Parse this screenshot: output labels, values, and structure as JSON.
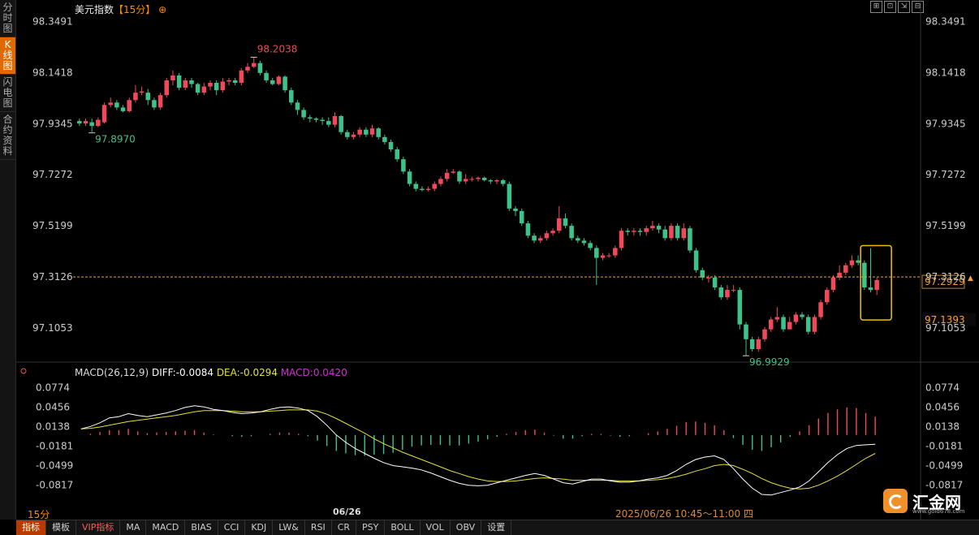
{
  "sidebar": {
    "items": [
      "分时图",
      "K线图",
      "闪电图",
      "合约资料"
    ],
    "active_index": 1
  },
  "header": {
    "name": "美元指数",
    "period": "【15分】",
    "add_icon": "⊕"
  },
  "window_buttons": [
    "⊞",
    "⊡",
    "⇲",
    "⊟"
  ],
  "colors": {
    "up": "#f04a5a",
    "down": "#3fc28a",
    "price_line": "#e8a33c",
    "diff": "#ffffff",
    "dea": "#e6e03a",
    "macd": "#d030d0",
    "highlight_box": "#f0c000"
  },
  "chart_data": [
    {
      "type": "candlestick",
      "title": "美元指数 15分",
      "y_ticks": [
        "98.3491",
        "98.1418",
        "97.9345",
        "97.7272",
        "97.5199",
        "97.3126",
        "97.1053"
      ],
      "ylim": [
        97.02,
        98.37
      ],
      "current_price": "97.2929",
      "current_line": 97.3126,
      "box_low_label": "97.1393",
      "annotations": {
        "high": "98.2038",
        "low": "96.9929",
        "left_low": "97.8970"
      },
      "x_label": "06/26",
      "date_range": "2025/06/26 10:45～11:00 四",
      "candles": [
        [
          97.945,
          97.935,
          97.955,
          97.925
        ],
        [
          97.935,
          97.945,
          97.955,
          97.925
        ],
        [
          97.94,
          97.925,
          97.955,
          97.9
        ],
        [
          97.925,
          97.95,
          97.96,
          97.92
        ],
        [
          97.94,
          98.01,
          98.02,
          97.935
        ],
        [
          98.01,
          98.02,
          98.04,
          98.0
        ],
        [
          98.02,
          98.0,
          98.03,
          97.99
        ],
        [
          98.0,
          97.985,
          98.01,
          97.98
        ],
        [
          97.985,
          98.03,
          98.04,
          97.98
        ],
        [
          98.03,
          98.06,
          98.09,
          98.02
        ],
        [
          98.06,
          98.065,
          98.085,
          98.05
        ],
        [
          98.06,
          98.03,
          98.075,
          98.01
        ],
        [
          98.03,
          98.0,
          98.04,
          97.99
        ],
        [
          98.0,
          98.05,
          98.06,
          97.99
        ],
        [
          98.05,
          98.11,
          98.12,
          98.04
        ],
        [
          98.11,
          98.13,
          98.15,
          98.09
        ],
        [
          98.13,
          98.08,
          98.14,
          98.07
        ],
        [
          98.08,
          98.11,
          98.12,
          98.07
        ],
        [
          98.11,
          98.095,
          98.12,
          98.08
        ],
        [
          98.095,
          98.06,
          98.1,
          98.05
        ],
        [
          98.06,
          98.085,
          98.1,
          98.05
        ],
        [
          98.085,
          98.1,
          98.11,
          98.07
        ],
        [
          98.1,
          98.07,
          98.11,
          98.05
        ],
        [
          98.07,
          98.105,
          98.12,
          98.06
        ],
        [
          98.105,
          98.11,
          98.12,
          98.09
        ],
        [
          98.11,
          98.1,
          98.12,
          98.09
        ],
        [
          98.1,
          98.15,
          98.16,
          98.09
        ],
        [
          98.15,
          98.165,
          98.18,
          98.14
        ],
        [
          98.165,
          98.18,
          98.2038,
          98.16
        ],
        [
          98.18,
          98.14,
          98.19,
          98.13
        ],
        [
          98.14,
          98.11,
          98.15,
          98.1
        ],
        [
          98.11,
          98.095,
          98.12,
          98.09
        ],
        [
          98.095,
          98.125,
          98.13,
          98.09
        ],
        [
          98.125,
          98.07,
          98.13,
          98.06
        ],
        [
          98.07,
          98.02,
          98.08,
          98.01
        ],
        [
          98.02,
          97.99,
          98.03,
          97.97
        ],
        [
          97.99,
          97.96,
          98.0,
          97.95
        ],
        [
          97.96,
          97.955,
          97.97,
          97.94
        ],
        [
          97.955,
          97.95,
          97.96,
          97.94
        ],
        [
          97.95,
          97.945,
          97.96,
          97.93
        ],
        [
          97.945,
          97.93,
          97.96,
          97.92
        ],
        [
          97.93,
          97.965,
          97.98,
          97.92
        ],
        [
          97.965,
          97.9,
          97.97,
          97.89
        ],
        [
          97.9,
          97.88,
          97.91,
          97.87
        ],
        [
          97.88,
          97.89,
          97.9,
          97.87
        ],
        [
          97.89,
          97.91,
          97.92,
          97.88
        ],
        [
          97.91,
          97.89,
          97.92,
          97.88
        ],
        [
          97.89,
          97.915,
          97.93,
          97.88
        ],
        [
          97.915,
          97.88,
          97.92,
          97.87
        ],
        [
          97.88,
          97.86,
          97.89,
          97.85
        ],
        [
          97.86,
          97.83,
          97.87,
          97.82
        ],
        [
          97.83,
          97.79,
          97.84,
          97.78
        ],
        [
          97.79,
          97.74,
          97.8,
          97.73
        ],
        [
          97.74,
          97.69,
          97.75,
          97.68
        ],
        [
          97.69,
          97.67,
          97.7,
          97.66
        ],
        [
          97.67,
          97.665,
          97.68,
          97.66
        ],
        [
          97.665,
          97.67,
          97.68,
          97.66
        ],
        [
          97.67,
          97.69,
          97.7,
          97.66
        ],
        [
          97.69,
          97.71,
          97.72,
          97.68
        ],
        [
          97.71,
          97.735,
          97.75,
          97.7
        ],
        [
          97.735,
          97.74,
          97.75,
          97.73
        ],
        [
          97.74,
          97.7,
          97.745,
          97.69
        ],
        [
          97.7,
          97.71,
          97.73,
          97.69
        ],
        [
          97.71,
          97.71,
          97.72,
          97.7
        ],
        [
          97.71,
          97.715,
          97.72,
          97.7
        ],
        [
          97.715,
          97.705,
          97.72,
          97.7
        ],
        [
          97.705,
          97.7,
          97.71,
          97.69
        ],
        [
          97.7,
          97.705,
          97.71,
          97.69
        ],
        [
          97.705,
          97.69,
          97.71,
          97.68
        ],
        [
          97.69,
          97.59,
          97.7,
          97.58
        ],
        [
          97.59,
          97.58,
          97.6,
          97.56
        ],
        [
          97.58,
          97.53,
          97.59,
          97.52
        ],
        [
          97.53,
          97.48,
          97.54,
          97.47
        ],
        [
          97.48,
          97.46,
          97.49,
          97.45
        ],
        [
          97.46,
          97.47,
          97.48,
          97.45
        ],
        [
          97.47,
          97.49,
          97.5,
          97.46
        ],
        [
          97.49,
          97.5,
          97.51,
          97.48
        ],
        [
          97.5,
          97.55,
          97.6,
          97.49
        ],
        [
          97.55,
          97.52,
          97.57,
          97.51
        ],
        [
          97.52,
          97.47,
          97.53,
          97.46
        ],
        [
          97.47,
          97.46,
          97.48,
          97.45
        ],
        [
          97.46,
          97.45,
          97.47,
          97.44
        ],
        [
          97.45,
          97.43,
          97.46,
          97.42
        ],
        [
          97.43,
          97.39,
          97.44,
          97.28
        ],
        [
          97.39,
          97.4,
          97.41,
          97.38
        ],
        [
          97.4,
          97.4,
          97.41,
          97.39
        ],
        [
          97.4,
          97.43,
          97.44,
          97.39
        ],
        [
          97.43,
          97.5,
          97.51,
          97.42
        ],
        [
          97.5,
          97.495,
          97.51,
          97.48
        ],
        [
          97.495,
          97.5,
          97.51,
          97.48
        ],
        [
          97.5,
          97.495,
          97.51,
          97.48
        ],
        [
          97.495,
          97.51,
          97.52,
          97.48
        ],
        [
          97.51,
          97.52,
          97.54,
          97.5
        ],
        [
          97.52,
          97.505,
          97.53,
          97.49
        ],
        [
          97.505,
          97.47,
          97.52,
          97.46
        ],
        [
          97.47,
          97.52,
          97.53,
          97.46
        ],
        [
          97.52,
          97.47,
          97.53,
          97.46
        ],
        [
          97.47,
          97.51,
          97.53,
          97.46
        ],
        [
          97.51,
          97.42,
          97.52,
          97.41
        ],
        [
          97.42,
          97.34,
          97.43,
          97.33
        ],
        [
          97.34,
          97.31,
          97.35,
          97.3
        ],
        [
          97.31,
          97.31,
          97.32,
          97.29
        ],
        [
          97.31,
          97.27,
          97.32,
          97.26
        ],
        [
          97.27,
          97.23,
          97.28,
          97.22
        ],
        [
          97.23,
          97.26,
          97.28,
          97.22
        ],
        [
          97.26,
          97.26,
          97.28,
          97.25
        ],
        [
          97.26,
          97.12,
          97.27,
          97.1
        ],
        [
          97.12,
          97.06,
          97.13,
          96.9929
        ],
        [
          97.06,
          97.02,
          97.07,
          97.01
        ],
        [
          97.02,
          97.06,
          97.07,
          97.01
        ],
        [
          97.06,
          97.1,
          97.11,
          97.05
        ],
        [
          97.1,
          97.14,
          97.15,
          97.09
        ],
        [
          97.14,
          97.15,
          97.19,
          97.13
        ],
        [
          97.15,
          97.1,
          97.16,
          97.09
        ],
        [
          97.1,
          97.13,
          97.15,
          97.1
        ],
        [
          97.13,
          97.16,
          97.17,
          97.12
        ],
        [
          97.16,
          97.15,
          97.17,
          97.14
        ],
        [
          97.15,
          97.09,
          97.16,
          97.08
        ],
        [
          97.09,
          97.15,
          97.16,
          97.08
        ],
        [
          97.15,
          97.21,
          97.22,
          97.14
        ],
        [
          97.21,
          97.26,
          97.27,
          97.2
        ],
        [
          97.26,
          97.31,
          97.32,
          97.25
        ],
        [
          97.31,
          97.33,
          97.36,
          97.3
        ],
        [
          97.33,
          97.36,
          97.37,
          97.32
        ],
        [
          97.36,
          97.38,
          97.4,
          97.35
        ],
        [
          97.38,
          97.37,
          97.4,
          97.36
        ],
        [
          97.37,
          97.27,
          97.38,
          97.26
        ],
        [
          97.27,
          97.26,
          97.43,
          97.25
        ],
        [
          97.26,
          97.3,
          97.31,
          97.24
        ]
      ]
    },
    {
      "type": "bar+line",
      "title": "MACD(26,12,9)",
      "diff_label": "DIFF:-0.0084",
      "dea_label": "DEA:-0.0294",
      "macd_label": "MACD:0.0420",
      "y_ticks": [
        "0.0774",
        "0.0456",
        "0.0138",
        "-0.0181",
        "-0.0499",
        "-0.0817"
      ],
      "ylim": [
        -0.105,
        0.09
      ],
      "series": [
        {
          "name": "DIFF",
          "values": [
            0.01,
            0.014,
            0.02,
            0.028,
            0.03,
            0.035,
            0.032,
            0.03,
            0.033,
            0.036,
            0.04,
            0.045,
            0.048,
            0.046,
            0.042,
            0.04,
            0.037,
            0.035,
            0.036,
            0.038,
            0.042,
            0.045,
            0.046,
            0.044,
            0.04,
            0.03,
            0.016,
            0.0,
            -0.012,
            -0.022,
            -0.03,
            -0.038,
            -0.045,
            -0.05,
            -0.052,
            -0.054,
            -0.057,
            -0.062,
            -0.068,
            -0.074,
            -0.079,
            -0.082,
            -0.083,
            -0.082,
            -0.078,
            -0.074,
            -0.07,
            -0.066,
            -0.063,
            -0.066,
            -0.072,
            -0.078,
            -0.08,
            -0.076,
            -0.072,
            -0.072,
            -0.075,
            -0.077,
            -0.077,
            -0.075,
            -0.072,
            -0.07,
            -0.066,
            -0.058,
            -0.048,
            -0.04,
            -0.036,
            -0.034,
            -0.04,
            -0.055,
            -0.072,
            -0.087,
            -0.097,
            -0.098,
            -0.094,
            -0.09,
            -0.085,
            -0.075,
            -0.06,
            -0.045,
            -0.032,
            -0.022,
            -0.017,
            -0.016,
            -0.015
          ]
        },
        {
          "name": "DEA",
          "values": [
            0.01,
            0.011,
            0.013,
            0.016,
            0.019,
            0.022,
            0.024,
            0.026,
            0.028,
            0.03,
            0.032,
            0.035,
            0.038,
            0.04,
            0.04,
            0.04,
            0.039,
            0.038,
            0.038,
            0.038,
            0.039,
            0.04,
            0.041,
            0.041,
            0.041,
            0.039,
            0.034,
            0.027,
            0.019,
            0.011,
            0.003,
            -0.006,
            -0.014,
            -0.021,
            -0.028,
            -0.034,
            -0.04,
            -0.046,
            -0.052,
            -0.058,
            -0.063,
            -0.068,
            -0.072,
            -0.075,
            -0.076,
            -0.076,
            -0.075,
            -0.073,
            -0.071,
            -0.07,
            -0.071,
            -0.072,
            -0.074,
            -0.074,
            -0.074,
            -0.074,
            -0.074,
            -0.075,
            -0.075,
            -0.075,
            -0.074,
            -0.073,
            -0.071,
            -0.068,
            -0.064,
            -0.059,
            -0.055,
            -0.05,
            -0.048,
            -0.05,
            -0.056,
            -0.063,
            -0.071,
            -0.078,
            -0.083,
            -0.087,
            -0.088,
            -0.087,
            -0.082,
            -0.075,
            -0.067,
            -0.058,
            -0.048,
            -0.038,
            -0.03
          ]
        },
        {
          "name": "MACD",
          "values": [
            0.0,
            0.002,
            0.005,
            0.008,
            0.008,
            0.01,
            0.006,
            0.003,
            0.004,
            0.005,
            0.006,
            0.007,
            0.008,
            0.004,
            0.001,
            0.0,
            -0.002,
            -0.003,
            -0.002,
            0.0,
            0.002,
            0.004,
            0.004,
            0.002,
            -0.002,
            -0.009,
            -0.018,
            -0.026,
            -0.03,
            -0.033,
            -0.034,
            -0.032,
            -0.031,
            -0.029,
            -0.024,
            -0.019,
            -0.017,
            -0.016,
            -0.016,
            -0.017,
            -0.017,
            -0.014,
            -0.011,
            -0.007,
            -0.003,
            0.002,
            0.005,
            0.008,
            0.009,
            0.004,
            -0.001,
            -0.006,
            -0.006,
            -0.002,
            0.002,
            0.002,
            -0.001,
            -0.003,
            -0.002,
            0.0,
            0.003,
            0.006,
            0.01,
            0.015,
            0.021,
            0.022,
            0.02,
            0.016,
            0.008,
            -0.005,
            -0.016,
            -0.024,
            -0.026,
            -0.02,
            -0.012,
            -0.003,
            0.006,
            0.016,
            0.027,
            0.036,
            0.042,
            0.045,
            0.044,
            0.036,
            0.03
          ]
        }
      ]
    }
  ],
  "footer": {
    "period": "15分"
  },
  "tabs": [
    "指标",
    "模板",
    "VIP指标",
    "MA",
    "MACD",
    "BIAS",
    "CCI",
    "KDJ",
    "LW&",
    "RSI",
    "CR",
    "PSY",
    "BOLL",
    "VOL",
    "OBV",
    "设置"
  ],
  "logo": {
    "text": "汇金网",
    "url": "www.gold678.com"
  }
}
